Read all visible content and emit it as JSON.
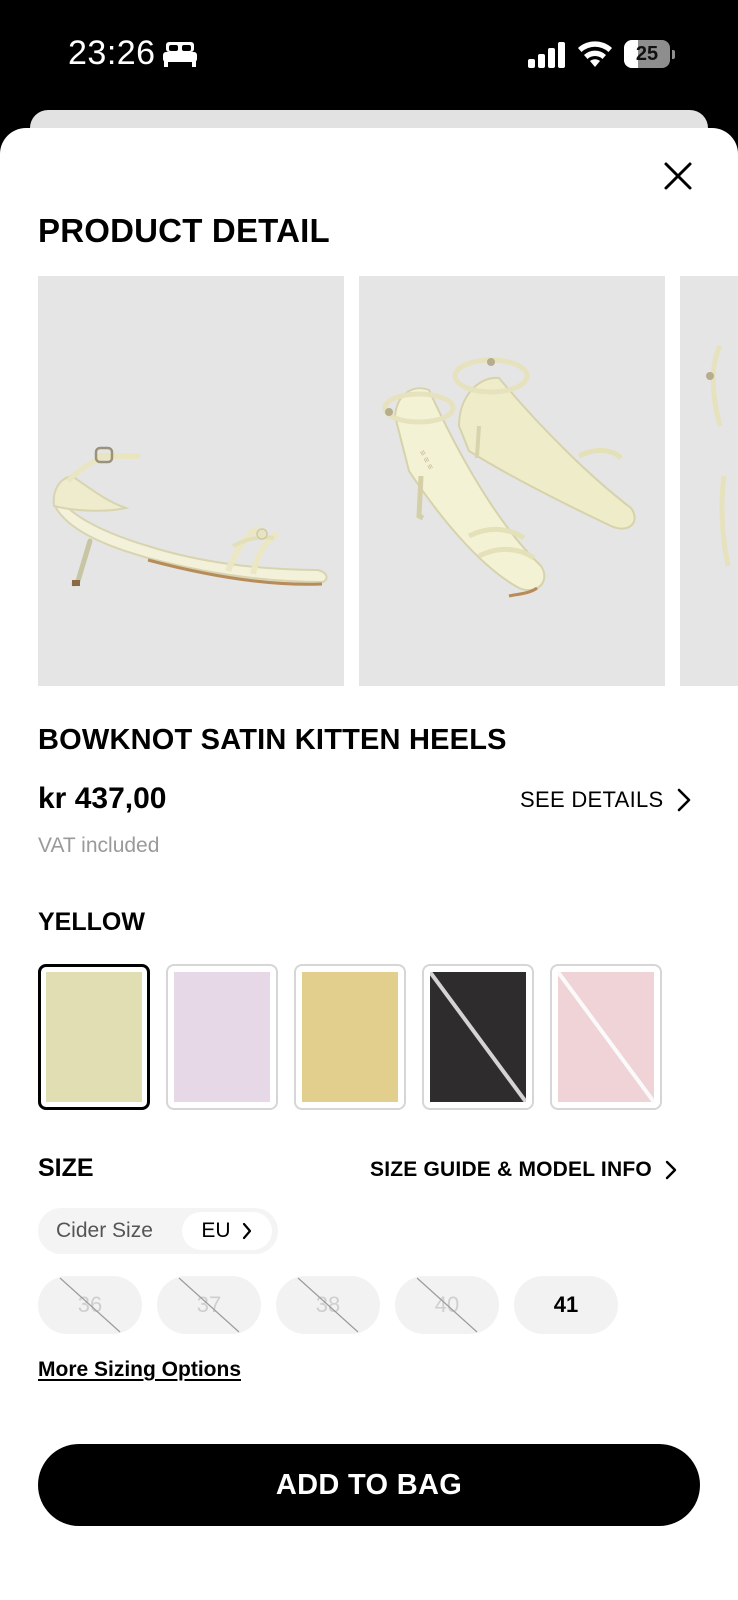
{
  "status_bar": {
    "time": "23:26",
    "battery_level": "25",
    "icons": [
      "bed-icon",
      "cellular-signal-icon",
      "wifi-icon",
      "battery-icon"
    ]
  },
  "header": {
    "title": "PRODUCT DETAIL",
    "close_icon": "close-icon"
  },
  "product": {
    "name": "BOWKNOT SATIN KITTEN HEELS",
    "price": "kr 437,00",
    "vat_note": "VAT included",
    "see_details_label": "SEE DETAILS",
    "images": [
      "side-view-photo",
      "pair-view-photo",
      "partial-third-photo"
    ]
  },
  "color": {
    "selected_name": "YELLOW",
    "swatches": [
      {
        "color": "#e0deb2",
        "selected": true,
        "available": true
      },
      {
        "color": "#e7d8e8",
        "selected": false,
        "available": true
      },
      {
        "color": "#e2cf8e",
        "selected": false,
        "available": true
      },
      {
        "color": "#2e2c2d",
        "selected": false,
        "available": false
      },
      {
        "color": "#efd3d7",
        "selected": false,
        "available": false
      }
    ]
  },
  "size": {
    "title": "SIZE",
    "guide_label": "SIZE GUIDE & MODEL INFO",
    "system_label": "Cider Size",
    "system_value": "EU",
    "options": [
      {
        "label": "36",
        "available": false
      },
      {
        "label": "37",
        "available": false
      },
      {
        "label": "38",
        "available": false
      },
      {
        "label": "40",
        "available": false
      },
      {
        "label": "41",
        "available": true
      }
    ],
    "more_options_label": "More Sizing Options"
  },
  "cta": {
    "add_to_bag_label": "ADD TO BAG"
  }
}
